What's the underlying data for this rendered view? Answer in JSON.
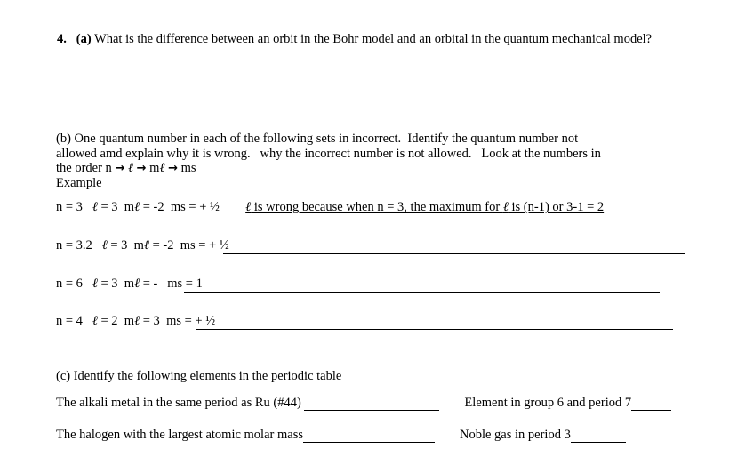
{
  "document": {
    "type": "chemistry-worksheet-scan",
    "background_color": "#ffffff",
    "text_color": "#000000"
  },
  "question_4": {
    "number": "4.",
    "part_a_label": "(a)",
    "part_a_text": "What is the difference between an orbit in the Bohr model and an orbital in the quantum mechanical model?"
  },
  "part_b": {
    "intro_line1": "(b) One quantum number in each of the following sets in incorrect.  Identify the quantum number not",
    "intro_line2": "allowed amd explain why it is wrong.   why the incorrect number is not allowed.   Look at the numbers in",
    "intro_line3_prefix": "the order n ",
    "arrow": "→",
    "symbol_ell": "ℓ",
    "symbol_mell_m": "m",
    "symbol_ms": "ms",
    "example_label": "Example",
    "rows": [
      {
        "n": "n = 3",
        "l_prefix": "",
        "l": " = 3",
        "ml": "m",
        "ml_value": " = -2",
        "ms": "ms = + ½",
        "answer": " is wrong because when n = 3, the maximum for ",
        "answer_tail": " is (n-1) or 3-1 = 2",
        "has_answer": true
      },
      {
        "n": "n = 3.2",
        "l": " = 3",
        "ml": "m",
        "ml_value": " = -2",
        "ms": "ms = + ½",
        "has_answer": false
      },
      {
        "n": "n = 6",
        "l": " = 3",
        "ml": "m",
        "ml_value": " = - ",
        "ms": "ms = 1",
        "has_answer": false
      },
      {
        "n": "n = 4",
        "l": " = 2",
        "ml": "m",
        "ml_value": " = 3",
        "ms": "ms = + ½",
        "has_answer": false
      }
    ]
  },
  "part_c": {
    "intro": "(c) Identify the following elements in the periodic table",
    "items": [
      {
        "prompt_left": "The alkali metal in the same period as Ru (#44)",
        "prompt_right": "Element in group 6 and period 7"
      },
      {
        "prompt_left": "The halogen with the largest atomic molar mass",
        "prompt_right": "Noble gas in period 3"
      }
    ]
  }
}
